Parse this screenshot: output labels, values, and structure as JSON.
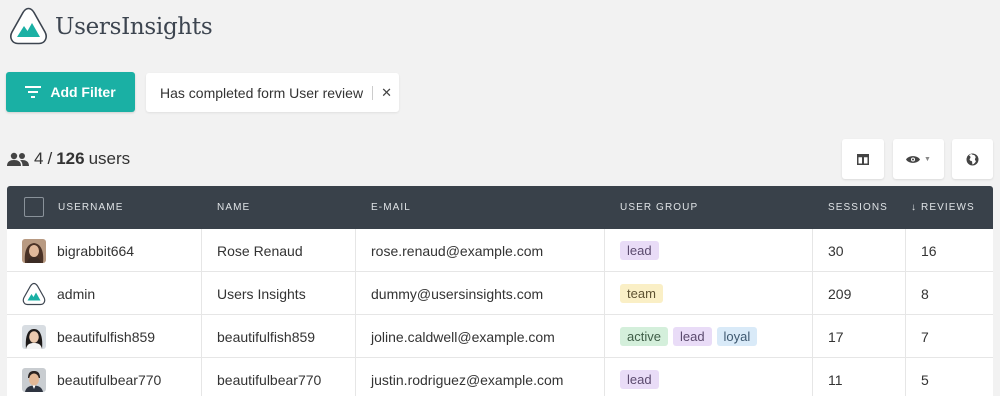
{
  "app": {
    "name": "UsersInsights",
    "logo_icon": "mountain-logo-icon",
    "accent": "#1ab0a4"
  },
  "toolbar": {
    "add_filter_label": "Add Filter",
    "filter_icon": "filter-icon",
    "active_filter": "Has completed form User review",
    "remove_filter_icon": "close-icon"
  },
  "summary": {
    "shown": "4",
    "separator": "/",
    "total": "126",
    "unit": "users",
    "icon": "people-icon"
  },
  "view_buttons": [
    {
      "icon": "columns-icon"
    },
    {
      "icon": "eye-icon",
      "has_dropdown": true
    },
    {
      "icon": "globe-icon"
    }
  ],
  "table": {
    "columns": [
      "USERNAME",
      "NAME",
      "E-MAIL",
      "USER GROUP",
      "SESSIONS",
      "REVIEWS"
    ],
    "sort": {
      "column": "REVIEWS",
      "direction": "desc",
      "indicator": "↓"
    },
    "rows": [
      {
        "username": "bigrabbit664",
        "name": "Rose Renaud",
        "email": "rose.renaud@example.com",
        "groups": [
          "lead"
        ],
        "sessions": "30",
        "reviews": "16",
        "avatar": "photo-female-1"
      },
      {
        "username": "admin",
        "name": "Users Insights",
        "email": "dummy@usersinsights.com",
        "groups": [
          "team"
        ],
        "sessions": "209",
        "reviews": "8",
        "avatar": "logo"
      },
      {
        "username": "beautifulfish859",
        "name": "beautifulfish859",
        "email": "joline.caldwell@example.com",
        "groups": [
          "active",
          "lead",
          "loyal"
        ],
        "sessions": "17",
        "reviews": "7",
        "avatar": "photo-female-2"
      },
      {
        "username": "beautifulbear770",
        "name": "beautifulbear770",
        "email": "justin.rodriguez@example.com",
        "groups": [
          "lead"
        ],
        "sessions": "11",
        "reviews": "5",
        "avatar": "photo-male-1"
      }
    ]
  },
  "tag_colors": {
    "lead": {
      "bg": "#e9dcf7",
      "fg": "#5b4a6e"
    },
    "team": {
      "bg": "#faefc6",
      "fg": "#5e5232"
    },
    "active": {
      "bg": "#d4efdb",
      "fg": "#3f5e47"
    },
    "loyal": {
      "bg": "#d9eaf8",
      "fg": "#3e5870"
    }
  }
}
